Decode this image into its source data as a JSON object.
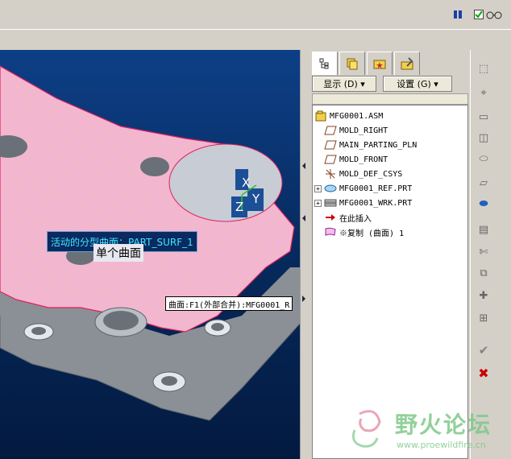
{
  "topbar": {
    "icons": [
      "pause-icon",
      "checkbox-icon",
      "glasses-icon"
    ]
  },
  "viewport": {
    "surface_label": "活动的分型曲面：PART_SURF_1",
    "surface_sub_label": "单个曲面",
    "tooltip": "曲面:F1(外部合并):MFG0001_R",
    "csys_axes": [
      "X",
      "Y",
      "Z"
    ]
  },
  "panel": {
    "tabs": [
      "model-tree-icon",
      "layers-icon",
      "favorites-icon",
      "tools-icon"
    ],
    "show_button": "显示 (D) ▾",
    "settings_button": "设置 (G) ▾",
    "tree": [
      {
        "label": "MFG0001.ASM",
        "icon": "assembly-icon",
        "level": 0,
        "expander": ""
      },
      {
        "label": "MOLD_RIGHT",
        "icon": "datum-plane-icon",
        "level": 1,
        "expander": ""
      },
      {
        "label": "MAIN_PARTING_PLN",
        "icon": "datum-plane-icon",
        "level": 1,
        "expander": ""
      },
      {
        "label": "MOLD_FRONT",
        "icon": "datum-plane-icon",
        "level": 1,
        "expander": ""
      },
      {
        "label": "MOLD_DEF_CSYS",
        "icon": "csys-icon",
        "level": 1,
        "expander": ""
      },
      {
        "label": "MFG0001_REF.PRT",
        "icon": "ref-part-icon",
        "level": 1,
        "expander": "+"
      },
      {
        "label": "MFG0001_WRK.PRT",
        "icon": "workpiece-icon",
        "level": 1,
        "expander": "+"
      },
      {
        "label": "在此插入",
        "icon": "insert-arrow-icon",
        "level": 1,
        "expander": ""
      },
      {
        "label": "※复制 (曲面) 1",
        "icon": "surface-copy-icon",
        "level": 1,
        "expander": ""
      }
    ]
  },
  "watermark": {
    "title": "野火论坛",
    "url": "www.proewildfire.cn"
  },
  "colors": {
    "viewport_top": "#0d3f86",
    "part_pink": "#f2b6d2",
    "part_gray": "#8a9096",
    "label_cyan": "#40e8ff",
    "tree_red_arrow": "#cc0000",
    "watermark_green": "#7fc88a"
  }
}
